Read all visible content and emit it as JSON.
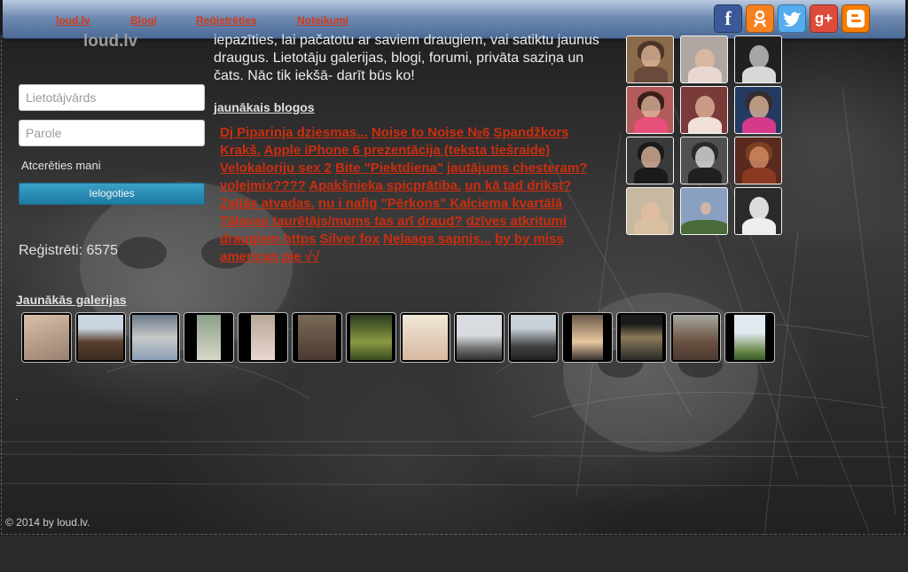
{
  "nav": {
    "links": [
      "loud.lv",
      "Blogi",
      "Reģistrēties",
      "Noteikumi"
    ]
  },
  "social": [
    {
      "icon": "facebook-icon",
      "glyph": "f",
      "color": "#3b5998"
    },
    {
      "icon": "odnoklassniki-icon",
      "glyph": "ok",
      "color": "#f58220"
    },
    {
      "icon": "twitter-icon",
      "glyph": "t",
      "color": "#55acee"
    },
    {
      "icon": "google-plus-icon",
      "glyph": "g+",
      "color": "#dd4b39"
    },
    {
      "icon": "blogger-icon",
      "glyph": "B",
      "color": "#f57d00"
    }
  ],
  "login": {
    "logo": "loud.lv",
    "username_placeholder": "Lietotājvārds",
    "password_placeholder": "Parole",
    "remember_label": "Atcerēties mani",
    "login_button": "Ielogoties",
    "registered_label": "Reģistrēti: 6575"
  },
  "intro": {
    "text": "iepazīties, lai pačatotu ar saviem draugiem, vai satiktu jaunus draugus. Lietotāju galerijas, blogi, forumi, privāta saziņa un čats. Nāc tik iekšā- darīt būs ko!"
  },
  "blogs": {
    "heading": "jaunākais blogos",
    "items": [
      "Dj Piparinja dziesmas...",
      "Noise to Noise №6",
      "Spandžkors Krakš.",
      "Apple iPhone 6 prezentācija (teksta tiešraide)",
      "Velokaloriju sex 2",
      "Bite \"Piektdiena\"",
      "jautājums chesteram?",
      "volejmix????",
      "Apakšnieka spicprātiba.",
      "un kā tad drikst?",
      "Zaļjās atvadas.",
      "nu i nafig",
      "\"Pērkons\" Kalciema kvartālā",
      "Tālavas taurētājs/mums tas arī draud?",
      "dzīves atkritumi",
      "draugiem https",
      "Silver fox",
      "Nelaags sapnis...",
      "by by miss american pie √√"
    ]
  },
  "galleries": {
    "heading": "Jaunākās galerijas"
  },
  "footer": {
    "text": "© 2014 by loud.lv."
  },
  "colors": {
    "link_red": "#cc2d0f",
    "nav_blue": "#6f8bb2",
    "login_button": "#2a8cb6"
  }
}
